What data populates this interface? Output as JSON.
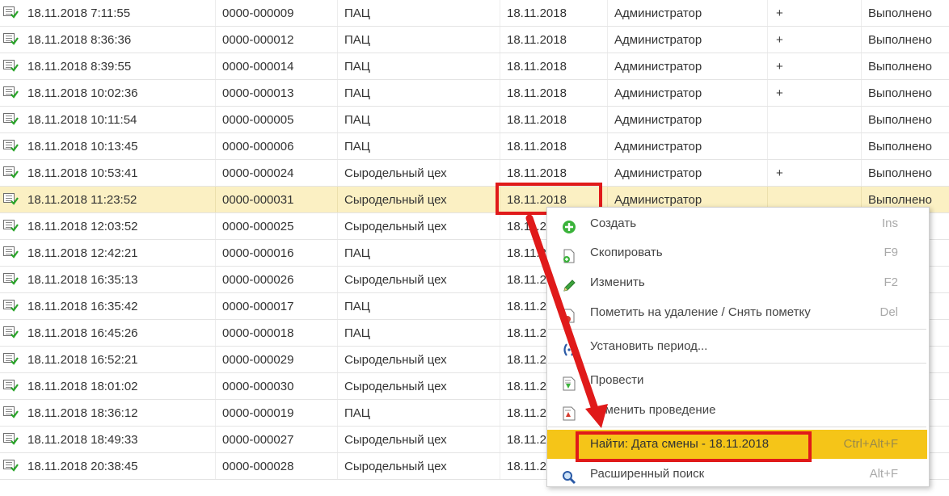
{
  "rows": [
    {
      "datetime": "18.11.2018 7:11:55",
      "number": "0000-000009",
      "department": "ПАЦ",
      "shift_date": "18.11.2018",
      "user": "Администратор",
      "flag": "+",
      "status": "Выполнено"
    },
    {
      "datetime": "18.11.2018 8:36:36",
      "number": "0000-000012",
      "department": "ПАЦ",
      "shift_date": "18.11.2018",
      "user": "Администратор",
      "flag": "+",
      "status": "Выполнено"
    },
    {
      "datetime": "18.11.2018 8:39:55",
      "number": "0000-000014",
      "department": "ПАЦ",
      "shift_date": "18.11.2018",
      "user": "Администратор",
      "flag": "+",
      "status": "Выполнено"
    },
    {
      "datetime": "18.11.2018 10:02:36",
      "number": "0000-000013",
      "department": "ПАЦ",
      "shift_date": "18.11.2018",
      "user": "Администратор",
      "flag": "+",
      "status": "Выполнено"
    },
    {
      "datetime": "18.11.2018 10:11:54",
      "number": "0000-000005",
      "department": "ПАЦ",
      "shift_date": "18.11.2018",
      "user": "Администратор",
      "flag": "",
      "status": "Выполнено"
    },
    {
      "datetime": "18.11.2018 10:13:45",
      "number": "0000-000006",
      "department": "ПАЦ",
      "shift_date": "18.11.2018",
      "user": "Администратор",
      "flag": "",
      "status": "Выполнено"
    },
    {
      "datetime": "18.11.2018 10:53:41",
      "number": "0000-000024",
      "department": "Сыродельный цех",
      "shift_date": "18.11.2018",
      "user": "Администратор",
      "flag": "+",
      "status": "Выполнено"
    },
    {
      "datetime": "18.11.2018 11:23:52",
      "number": "0000-000031",
      "department": "Сыродельный цех",
      "shift_date": "18.11.2018",
      "user": "Администратор",
      "flag": "",
      "status": "Выполнено"
    },
    {
      "datetime": "18.11.2018 12:03:52",
      "number": "0000-000025",
      "department": "Сыродельный цех",
      "shift_date": "18.11.2",
      "user": "",
      "flag": "",
      "status": ""
    },
    {
      "datetime": "18.11.2018 12:42:21",
      "number": "0000-000016",
      "department": "ПАЦ",
      "shift_date": "18.11.2",
      "user": "",
      "flag": "",
      "status": ""
    },
    {
      "datetime": "18.11.2018 16:35:13",
      "number": "0000-000026",
      "department": "Сыродельный цех",
      "shift_date": "18.11.2",
      "user": "",
      "flag": "",
      "status": ""
    },
    {
      "datetime": "18.11.2018 16:35:42",
      "number": "0000-000017",
      "department": "ПАЦ",
      "shift_date": "18.11.2",
      "user": "",
      "flag": "",
      "status": ""
    },
    {
      "datetime": "18.11.2018 16:45:26",
      "number": "0000-000018",
      "department": "ПАЦ",
      "shift_date": "18.11.2",
      "user": "",
      "flag": "",
      "status": ""
    },
    {
      "datetime": "18.11.2018 16:52:21",
      "number": "0000-000029",
      "department": "Сыродельный цех",
      "shift_date": "18.11.2",
      "user": "",
      "flag": "",
      "status": ""
    },
    {
      "datetime": "18.11.2018 18:01:02",
      "number": "0000-000030",
      "department": "Сыродельный цех",
      "shift_date": "18.11.2",
      "user": "",
      "flag": "",
      "status": ""
    },
    {
      "datetime": "18.11.2018 18:36:12",
      "number": "0000-000019",
      "department": "ПАЦ",
      "shift_date": "18.11.2",
      "user": "",
      "flag": "",
      "status": ""
    },
    {
      "datetime": "18.11.2018 18:49:33",
      "number": "0000-000027",
      "department": "Сыродельный цех",
      "shift_date": "18.11.2",
      "user": "",
      "flag": "",
      "status": ""
    },
    {
      "datetime": "18.11.2018 20:38:45",
      "number": "0000-000028",
      "department": "Сыродельный цех",
      "shift_date": "18.11.2",
      "user": "",
      "flag": "",
      "status": ""
    }
  ],
  "context_menu": {
    "create": {
      "label": "Создать",
      "shortcut": "Ins",
      "icon": "plus-circle-icon"
    },
    "copy": {
      "label": "Скопировать",
      "shortcut": "F9",
      "icon": "copy-icon"
    },
    "edit": {
      "label": "Изменить",
      "shortcut": "F2",
      "icon": "pencil-icon"
    },
    "mark_delete": {
      "label": "Пометить на удаление / Снять пометку",
      "shortcut": "Del",
      "icon": "delete-mark-icon"
    },
    "set_period": {
      "label": "Установить период...",
      "shortcut": "",
      "icon": "period-icon"
    },
    "post": {
      "label": "Провести",
      "shortcut": "",
      "icon": "post-icon"
    },
    "unpost": {
      "label": "Отменить проведение",
      "shortcut": "",
      "icon": "unpost-icon"
    },
    "find": {
      "label": "Найти: Дата смены - 18.11.2018",
      "shortcut": "Ctrl+Alt+F",
      "icon": ""
    },
    "advanced_search": {
      "label": "Расширенный поиск",
      "shortcut": "Alt+F",
      "icon": "magnifier-icon"
    }
  },
  "colors": {
    "selected_row": "#fbf0c3",
    "menu_active": "#f5c518",
    "annotation": "#e01a1a",
    "check": "#2aa52a"
  }
}
